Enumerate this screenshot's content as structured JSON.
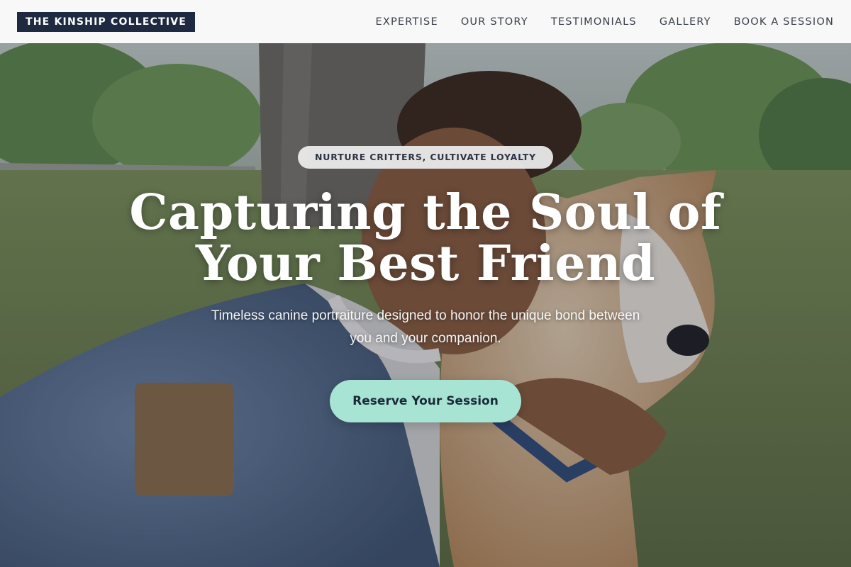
{
  "brand": {
    "logo_text": "THE KINSHIP COLLECTIVE"
  },
  "nav": {
    "items": [
      {
        "label": "EXPERTISE"
      },
      {
        "label": "OUR STORY"
      },
      {
        "label": "TESTIMONIALS"
      },
      {
        "label": "GALLERY"
      },
      {
        "label": "BOOK A SESSION"
      }
    ]
  },
  "hero": {
    "eyebrow": "NURTURE CRITTERS, CULTIVATE LOYALTY",
    "title_line1": "Capturing the Soul of",
    "title_line2": "Your Best Friend",
    "subtitle": "Timeless canine portraiture designed to honor the unique bond between you and your companion.",
    "cta_label": "Reserve Your Session",
    "background_subject": "woman-with-shiba-inu-dog-in-park-photo"
  },
  "colors": {
    "logo_bg": "#1f2a40",
    "cta_bg": "#a7e4d4",
    "cta_text": "#1c2a38",
    "header_bg": "#ffffff",
    "nav_text": "#3a3f4a"
  }
}
